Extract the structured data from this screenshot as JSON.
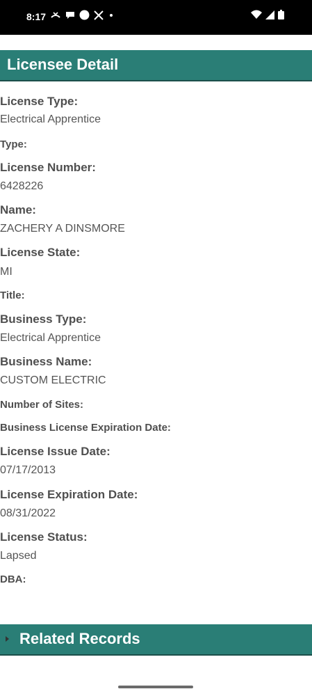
{
  "status_bar": {
    "time": "8:17",
    "left_icons": [
      "missed-call-icon",
      "chat-bubble-icon",
      "circle-icon",
      "x-app-icon",
      "dot-icon"
    ],
    "right_icons": [
      "wifi-icon",
      "cell-signal-icon",
      "battery-icon"
    ]
  },
  "header": {
    "title": "Licensee Detail"
  },
  "fields": {
    "license_type_label": "License Type:",
    "license_type_value": "Electrical Apprentice",
    "type_label": "Type:",
    "license_number_label": "License Number:",
    "license_number_value": "6428226",
    "name_label": "Name:",
    "name_value": "ZACHERY A DINSMORE",
    "license_state_label": "License State:",
    "license_state_value": "MI",
    "title_label": "Title:",
    "business_type_label": "Business Type:",
    "business_type_value": "Electrical Apprentice",
    "business_name_label": "Business Name:",
    "business_name_value": "CUSTOM ELECTRIC",
    "number_of_sites_label": "Number of Sites:",
    "business_license_exp_label": "Business License Expiration Date:",
    "license_issue_date_label": "License Issue Date:",
    "license_issue_date_value": "07/17/2013",
    "license_exp_date_label": "License Expiration Date:",
    "license_exp_date_value": "08/31/2022",
    "license_status_label": "License Status:",
    "license_status_value": "Lapsed",
    "dba_label": "DBA:"
  },
  "related": {
    "title": "Related Records"
  },
  "colors": {
    "header_bg": "#2a7e76",
    "status_bar_bg": "#000000"
  }
}
